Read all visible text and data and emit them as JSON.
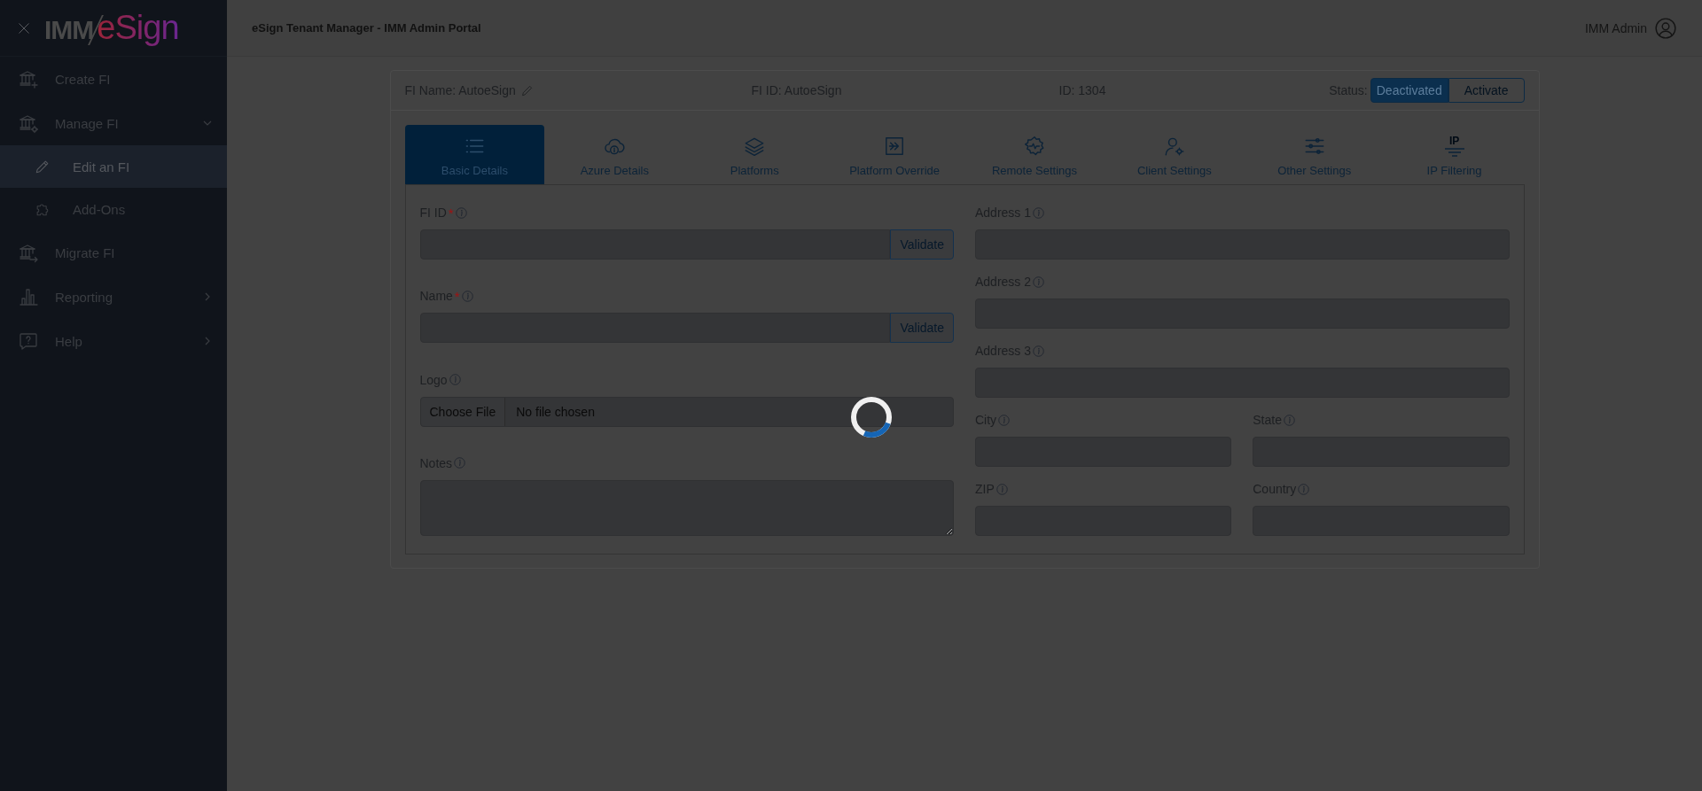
{
  "sidebar": {
    "logo": {
      "left": "IMM",
      "right": "eSign"
    },
    "items": [
      {
        "label": "Create FI",
        "selected": false
      },
      {
        "label": "Manage FI",
        "selected": false,
        "expanded": true,
        "children": [
          {
            "label": "Edit an FI",
            "selected": true
          },
          {
            "label": "Add-Ons",
            "selected": false
          }
        ]
      },
      {
        "label": "Migrate FI",
        "selected": false
      },
      {
        "label": "Reporting",
        "selected": false,
        "expanded": false
      },
      {
        "label": "Help",
        "selected": false,
        "expanded": false
      }
    ]
  },
  "header": {
    "title": "eSign Tenant Manager - IMM Admin Portal",
    "user": "IMM Admin"
  },
  "fi_bar": {
    "name": "FI Name: AutoeSign",
    "fi_id": "FI ID: AutoeSign",
    "id": "ID: 1304",
    "status_label": "Status:",
    "status_buttons": [
      {
        "label": "Deactivated",
        "selected": true
      },
      {
        "label": "Activate",
        "selected": false
      }
    ]
  },
  "tabs": [
    {
      "label": "Basic Details",
      "selected": true
    },
    {
      "label": "Azure Details",
      "selected": false
    },
    {
      "label": "Platforms",
      "selected": false
    },
    {
      "label": "Platform Override",
      "selected": false
    },
    {
      "label": "Remote Settings",
      "selected": false
    },
    {
      "label": "Client Settings",
      "selected": false
    },
    {
      "label": "Other Settings",
      "selected": false
    },
    {
      "label": "IP Filtering",
      "selected": false,
      "icon_text": "IP"
    }
  ],
  "form": {
    "left": [
      {
        "label": "FI ID",
        "required_mark": "*",
        "kind": "validate",
        "button": "Validate"
      },
      {
        "label": "Name",
        "required_mark": "*",
        "kind": "validate",
        "button": "Validate"
      },
      {
        "label": "Logo",
        "kind": "file",
        "button": "Choose File",
        "value": "No file chosen"
      },
      {
        "label": "Notes",
        "kind": "textarea"
      }
    ],
    "right": [
      {
        "fields": [
          {
            "label": "Address 1"
          }
        ]
      },
      {
        "fields": [
          {
            "label": "Address 2"
          }
        ]
      },
      {
        "fields": [
          {
            "label": "Address 3"
          }
        ]
      },
      {
        "fields": [
          {
            "label": "City"
          },
          {
            "label": "State"
          }
        ]
      },
      {
        "fields": [
          {
            "label": "ZIP"
          },
          {
            "label": "Country"
          }
        ]
      }
    ]
  },
  "loading": true
}
